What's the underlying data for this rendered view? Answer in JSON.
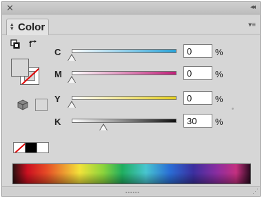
{
  "window": {
    "close_glyph": "✕",
    "collapse_glyph": "◂◂"
  },
  "tab": {
    "label": "Color",
    "menu_glyph": "▾≡"
  },
  "icons": {
    "swap_fill_stroke": "swap-arrows-icon",
    "default_fill_stroke": "default-swatches-icon",
    "out_of_gamut": "cube-icon"
  },
  "channels": [
    {
      "label": "C",
      "value": "0",
      "unit": "%",
      "level": 0,
      "gradient_start": "#ffffff",
      "gradient_end": "#2aa3d8"
    },
    {
      "label": "M",
      "value": "0",
      "unit": "%",
      "level": 0,
      "gradient_start": "#ffffff",
      "gradient_end": "#c0207a"
    },
    {
      "label": "Y",
      "value": "0",
      "unit": "%",
      "level": 0,
      "gradient_start": "#ffffff",
      "gradient_end": "#e6d020"
    },
    {
      "label": "K",
      "value": "30",
      "unit": "%",
      "level": 30,
      "gradient_start": "#ffffff",
      "gradient_end": "#111111"
    }
  ],
  "swatch_buttons": [
    "none",
    "black",
    "white"
  ],
  "colors": {
    "panel_bg": "#d6d6d6",
    "none_slash": "#e00000"
  }
}
